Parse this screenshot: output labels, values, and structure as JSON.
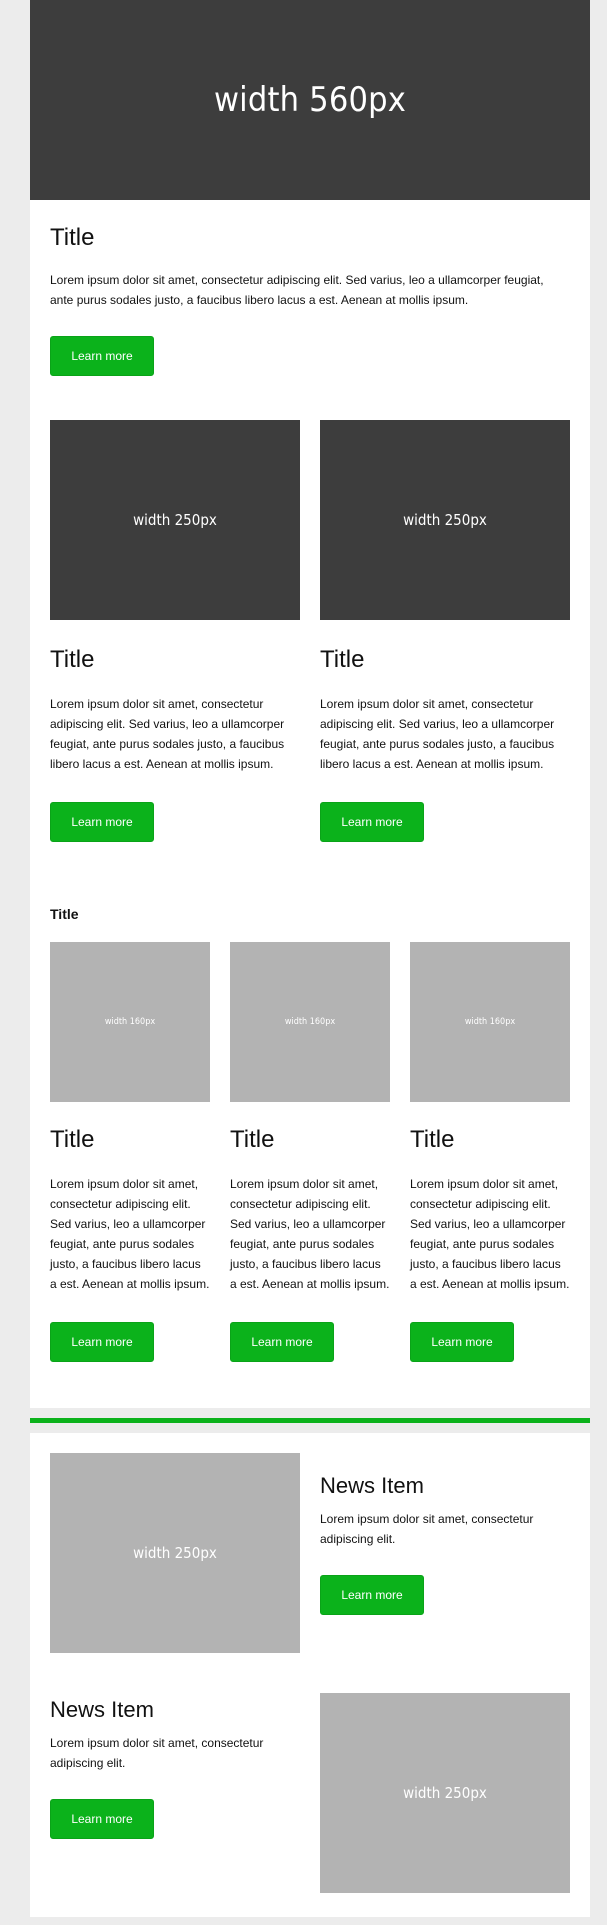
{
  "hero": {
    "label": "width 560px"
  },
  "section1": {
    "title": "Title",
    "body": "Lorem ipsum dolor sit amet, consectetur adipiscing elit. Sed varius, leo a ullamcorper feugiat, ante purus sodales justo, a faucibus libero lacus a est. Aenean at mollis ipsum.",
    "button": "Learn more"
  },
  "two_col": [
    {
      "image_label": "width 250px",
      "title": "Title",
      "body": "Lorem ipsum dolor sit amet, consectetur adipiscing elit. Sed varius, leo a ullamcorper feugiat, ante purus sodales justo, a faucibus libero lacus a est. Aenean at mollis ipsum.",
      "button": "Learn more"
    },
    {
      "image_label": "width 250px",
      "title": "Title",
      "body": "Lorem ipsum dolor sit amet, consectetur adipiscing elit. Sed varius, leo a ullamcorper feugiat, ante purus sodales justo, a faucibus libero lacus a est. Aenean at mollis ipsum.",
      "button": "Learn more"
    }
  ],
  "three_col": {
    "title": "Title",
    "items": [
      {
        "image_label": "width 160px",
        "title": "Title",
        "body": "Lorem ipsum dolor sit amet, consectetur adipiscing elit. Sed varius, leo a ullamcorper feugiat, ante purus sodales justo, a faucibus libero lacus a est. Aenean at mollis ipsum.",
        "button": "Learn more"
      },
      {
        "image_label": "width 160px",
        "title": "Title",
        "body": "Lorem ipsum dolor sit amet, consectetur adipiscing elit. Sed varius, leo a ullamcorper feugiat, ante purus sodales justo, a faucibus libero lacus a est. Aenean at mollis ipsum.",
        "button": "Learn more"
      },
      {
        "image_label": "width 160px",
        "title": "Title",
        "body": "Lorem ipsum dolor sit amet, consectetur adipiscing elit. Sed varius, leo a ullamcorper feugiat, ante purus sodales justo, a faucibus libero lacus a est. Aenean at mollis ipsum.",
        "button": "Learn more"
      }
    ]
  },
  "news": [
    {
      "image_label": "width 250px",
      "title": "News Item",
      "body": "Lorem ipsum dolor sit amet, consectetur adipiscing elit.",
      "button": "Learn more"
    },
    {
      "image_label": "width 250px",
      "title": "News Item",
      "body": "Lorem ipsum dolor sit amet, consectetur adipiscing elit.",
      "button": "Learn more"
    }
  ],
  "colors": {
    "page_bg": "#ececec",
    "card_bg": "#ffffff",
    "dark_placeholder": "#3d3d3d",
    "light_placeholder": "#b3b3b3",
    "accent_green": "#0bb21b"
  }
}
